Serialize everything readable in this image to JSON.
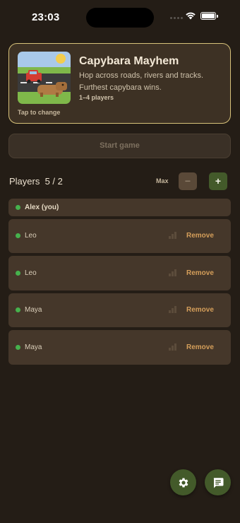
{
  "status_bar": {
    "time": "23:03"
  },
  "game": {
    "title": "Capybara Mayhem",
    "description": "Hop across roads, rivers and tracks. Furthest capybara wins.",
    "players_range": "1–4 players",
    "tap_hint": "Tap to change"
  },
  "start_button": {
    "label": "Start game"
  },
  "players": {
    "title": "Players",
    "count": "5 / 2",
    "max_label": "Max",
    "minus": "−",
    "plus": "+",
    "list": [
      {
        "name": "Alex (you)",
        "removable": false
      },
      {
        "name": "Leo",
        "removable": true,
        "remove_label": "Remove"
      },
      {
        "name": "Leo",
        "removable": true,
        "remove_label": "Remove"
      },
      {
        "name": "Maya",
        "removable": true,
        "remove_label": "Remove"
      },
      {
        "name": "Maya",
        "removable": true,
        "remove_label": "Remove"
      }
    ]
  },
  "fabs": {
    "left_icon": "gear-icon",
    "right_icon": "chat-icon"
  },
  "colors": {
    "accent_green": "#435a2a",
    "online_dot": "#46b24d",
    "remove": "#d49e5a",
    "card_border": "#d7c27a"
  }
}
